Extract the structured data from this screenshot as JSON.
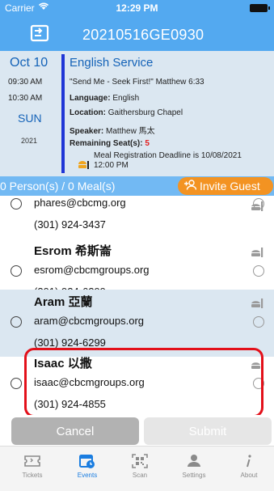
{
  "status_bar": {
    "carrier": "Carrier",
    "time": "12:29 PM"
  },
  "header": {
    "title": "20210516GE0930",
    "icon": "sign-in-icon"
  },
  "event": {
    "month_day": "Oct 10",
    "start_time": "09:30 AM",
    "end_time": "10:30 AM",
    "weekday": "SUN",
    "year": "2021",
    "title": "English Service",
    "verse": "\"Send Me - Seek First!\" Matthew 6:33",
    "language_label": "Language:",
    "language": "English",
    "location_label": "Location:",
    "location": "Gaithersburg Chapel",
    "speaker_label": "Speaker:",
    "speaker": "Matthew 馬太",
    "seats_label": "Remaining Seat(s):",
    "seats": "5",
    "meal_deadline": "Meal Registration Deadline is 10/08/2021",
    "meal_deadline_time": "12:00 PM"
  },
  "summary": {
    "text": "0 Person(s) / 0 Meal(s)",
    "invite_label": "Invite Guest"
  },
  "guests": [
    {
      "name": "",
      "email": "phares@cbcmg.org",
      "phone": "(301) 924-3437"
    },
    {
      "name": "Esrom 希斯崙",
      "email": "esrom@cbcmgroups.org",
      "phone": "(301) 924-6299"
    },
    {
      "name": "Aram 亞蘭",
      "email": "aram@cbcmgroups.org",
      "phone": "(301) 924-6299"
    },
    {
      "name": "Isaac 以撒",
      "email": "isaac@cbcmgroups.org",
      "phone": "(301) 924-4855"
    }
  ],
  "actions": {
    "cancel": "Cancel",
    "submit": "Submit"
  },
  "tabs": [
    {
      "label": "Tickets",
      "icon": "ticket-icon"
    },
    {
      "label": "Events",
      "icon": "calendar-clock-icon",
      "active": true
    },
    {
      "label": "Scan",
      "icon": "qr-code-icon"
    },
    {
      "label": "Settings",
      "icon": "person-icon"
    },
    {
      "label": "About",
      "icon": "info-icon"
    }
  ],
  "colors": {
    "primary": "#53a9f0",
    "panel": "#dbe7f1",
    "date_blue": "#1563b8",
    "invite": "#f39322",
    "seats_red": "#e21f1f",
    "highlight": "#e3101a",
    "tab_active": "#1a7de0"
  }
}
